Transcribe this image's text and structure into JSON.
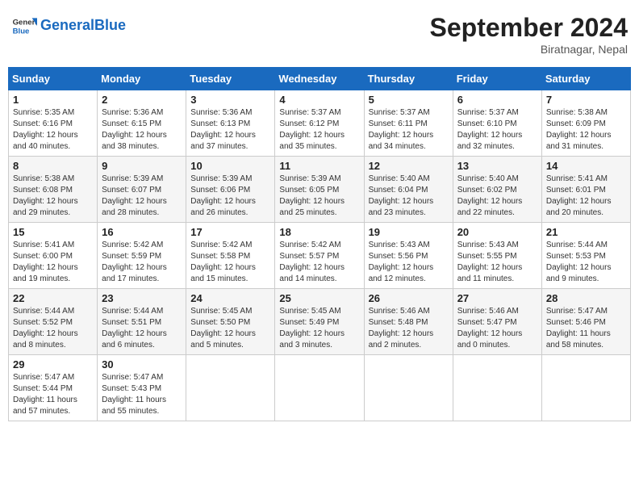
{
  "header": {
    "logo_text_general": "General",
    "logo_text_blue": "Blue",
    "month_title": "September 2024",
    "subtitle": "Biratnagar, Nepal"
  },
  "weekdays": [
    "Sunday",
    "Monday",
    "Tuesday",
    "Wednesday",
    "Thursday",
    "Friday",
    "Saturday"
  ],
  "weeks": [
    [
      {
        "day": "1",
        "sunrise": "5:35 AM",
        "sunset": "6:16 PM",
        "daylight": "12 hours and 40 minutes."
      },
      {
        "day": "2",
        "sunrise": "5:36 AM",
        "sunset": "6:15 PM",
        "daylight": "12 hours and 38 minutes."
      },
      {
        "day": "3",
        "sunrise": "5:36 AM",
        "sunset": "6:13 PM",
        "daylight": "12 hours and 37 minutes."
      },
      {
        "day": "4",
        "sunrise": "5:37 AM",
        "sunset": "6:12 PM",
        "daylight": "12 hours and 35 minutes."
      },
      {
        "day": "5",
        "sunrise": "5:37 AM",
        "sunset": "6:11 PM",
        "daylight": "12 hours and 34 minutes."
      },
      {
        "day": "6",
        "sunrise": "5:37 AM",
        "sunset": "6:10 PM",
        "daylight": "12 hours and 32 minutes."
      },
      {
        "day": "7",
        "sunrise": "5:38 AM",
        "sunset": "6:09 PM",
        "daylight": "12 hours and 31 minutes."
      }
    ],
    [
      {
        "day": "8",
        "sunrise": "5:38 AM",
        "sunset": "6:08 PM",
        "daylight": "12 hours and 29 minutes."
      },
      {
        "day": "9",
        "sunrise": "5:39 AM",
        "sunset": "6:07 PM",
        "daylight": "12 hours and 28 minutes."
      },
      {
        "day": "10",
        "sunrise": "5:39 AM",
        "sunset": "6:06 PM",
        "daylight": "12 hours and 26 minutes."
      },
      {
        "day": "11",
        "sunrise": "5:39 AM",
        "sunset": "6:05 PM",
        "daylight": "12 hours and 25 minutes."
      },
      {
        "day": "12",
        "sunrise": "5:40 AM",
        "sunset": "6:04 PM",
        "daylight": "12 hours and 23 minutes."
      },
      {
        "day": "13",
        "sunrise": "5:40 AM",
        "sunset": "6:02 PM",
        "daylight": "12 hours and 22 minutes."
      },
      {
        "day": "14",
        "sunrise": "5:41 AM",
        "sunset": "6:01 PM",
        "daylight": "12 hours and 20 minutes."
      }
    ],
    [
      {
        "day": "15",
        "sunrise": "5:41 AM",
        "sunset": "6:00 PM",
        "daylight": "12 hours and 19 minutes."
      },
      {
        "day": "16",
        "sunrise": "5:42 AM",
        "sunset": "5:59 PM",
        "daylight": "12 hours and 17 minutes."
      },
      {
        "day": "17",
        "sunrise": "5:42 AM",
        "sunset": "5:58 PM",
        "daylight": "12 hours and 15 minutes."
      },
      {
        "day": "18",
        "sunrise": "5:42 AM",
        "sunset": "5:57 PM",
        "daylight": "12 hours and 14 minutes."
      },
      {
        "day": "19",
        "sunrise": "5:43 AM",
        "sunset": "5:56 PM",
        "daylight": "12 hours and 12 minutes."
      },
      {
        "day": "20",
        "sunrise": "5:43 AM",
        "sunset": "5:55 PM",
        "daylight": "12 hours and 11 minutes."
      },
      {
        "day": "21",
        "sunrise": "5:44 AM",
        "sunset": "5:53 PM",
        "daylight": "12 hours and 9 minutes."
      }
    ],
    [
      {
        "day": "22",
        "sunrise": "5:44 AM",
        "sunset": "5:52 PM",
        "daylight": "12 hours and 8 minutes."
      },
      {
        "day": "23",
        "sunrise": "5:44 AM",
        "sunset": "5:51 PM",
        "daylight": "12 hours and 6 minutes."
      },
      {
        "day": "24",
        "sunrise": "5:45 AM",
        "sunset": "5:50 PM",
        "daylight": "12 hours and 5 minutes."
      },
      {
        "day": "25",
        "sunrise": "5:45 AM",
        "sunset": "5:49 PM",
        "daylight": "12 hours and 3 minutes."
      },
      {
        "day": "26",
        "sunrise": "5:46 AM",
        "sunset": "5:48 PM",
        "daylight": "12 hours and 2 minutes."
      },
      {
        "day": "27",
        "sunrise": "5:46 AM",
        "sunset": "5:47 PM",
        "daylight": "12 hours and 0 minutes."
      },
      {
        "day": "28",
        "sunrise": "5:47 AM",
        "sunset": "5:46 PM",
        "daylight": "11 hours and 58 minutes."
      }
    ],
    [
      {
        "day": "29",
        "sunrise": "5:47 AM",
        "sunset": "5:44 PM",
        "daylight": "11 hours and 57 minutes."
      },
      {
        "day": "30",
        "sunrise": "5:47 AM",
        "sunset": "5:43 PM",
        "daylight": "11 hours and 55 minutes."
      },
      null,
      null,
      null,
      null,
      null
    ]
  ]
}
